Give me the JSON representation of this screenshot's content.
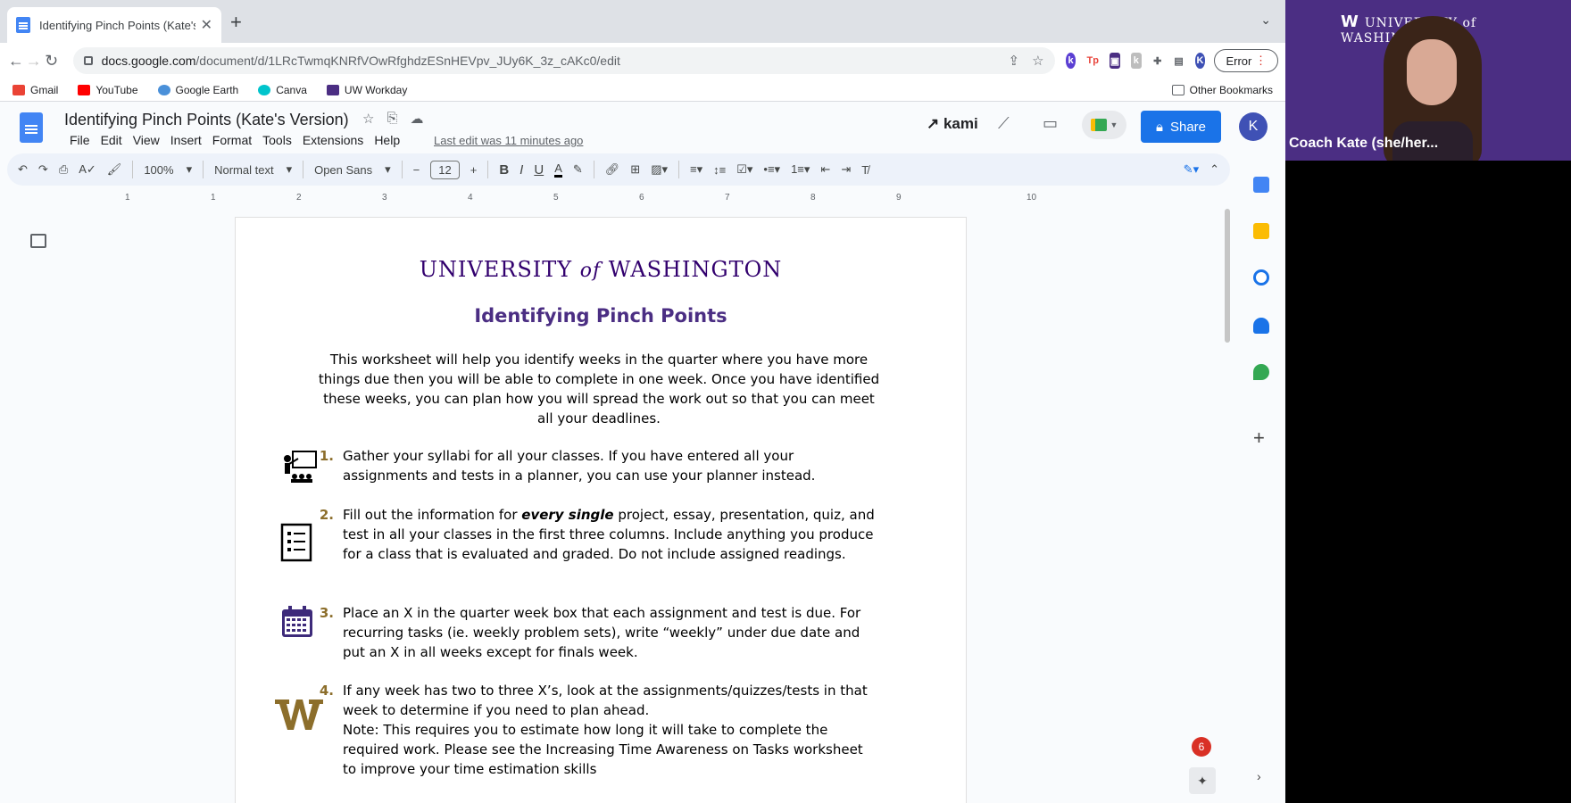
{
  "browser": {
    "tab_title": "Identifying Pinch Points (Kate's",
    "url_host": "docs.google.com",
    "url_path": "/document/d/1LRcTwmqKNRfVOwRfghdzESnHEVpv_JUy6K_3z_cAKc0/edit",
    "error_label": "Error",
    "bookmarks": [
      "Gmail",
      "YouTube",
      "Google Earth",
      "Canva",
      "UW Workday"
    ],
    "other_bookmarks": "Other Bookmarks"
  },
  "docs": {
    "title": "Identifying Pinch Points (Kate's Version)",
    "menu": [
      "File",
      "Edit",
      "View",
      "Insert",
      "Format",
      "Tools",
      "Extensions",
      "Help"
    ],
    "last_edit": "Last edit was 11 minutes ago",
    "kami": "kami",
    "share": "Share",
    "avatar": "K",
    "notifications": "6"
  },
  "format_toolbar": {
    "zoom": "100%",
    "style": "Normal text",
    "font": "Open Sans",
    "font_size": "12"
  },
  "ruler": [
    "1",
    "1",
    "2",
    "3",
    "4",
    "5",
    "6",
    "7",
    "8",
    "9",
    "10"
  ],
  "document": {
    "uw_header_1": "UNIVERSITY",
    "uw_header_of": "of",
    "uw_header_2": "WASHINGTON",
    "heading": "Identifying Pinch Points",
    "intro": "This worksheet will help you identify weeks in the quarter where you have more things due then you will be able to complete in one week.  Once you have identified these weeks, you can plan how you will spread the work out so that you can meet all your deadlines.",
    "steps": [
      {
        "num": "1.",
        "text": "Gather your syllabi for all your classes.  If you have entered all your assignments and tests in a planner, you can use your planner instead."
      },
      {
        "num": "2.",
        "text_a": "Fill out the information for ",
        "text_bold": "every single",
        "text_b": " project, essay, presentation, quiz, and test in all your classes in the first three columns.  Include anything you produce for a class that is evaluated and graded.  Do not include assigned readings."
      },
      {
        "num": "3.",
        "text": "Place an X in the quarter week box that each assignment and test is due.  For recurring tasks (ie. weekly problem sets), write “weekly” under due date and put an X in all weeks except for finals week."
      },
      {
        "num": "4.",
        "text_a": "If any week has two to three X’s, look at the assignments/quizzes/tests in that week to determine if you need to plan ahead.",
        "text_b": "Note: This requires you to estimate how long it will take to complete the required work.  Please see the Increasing Time Awareness on Tasks worksheet to improve your time estimation skills"
      }
    ]
  },
  "video": {
    "logo_w": "W",
    "logo_text": "UNIVERSITY of WASHINGTON",
    "name": "Coach Kate (she/her..."
  },
  "colors": {
    "uw_purple": "#4b2e83",
    "uw_gold": "#8c6e2b",
    "share_blue": "#1a73e8"
  }
}
